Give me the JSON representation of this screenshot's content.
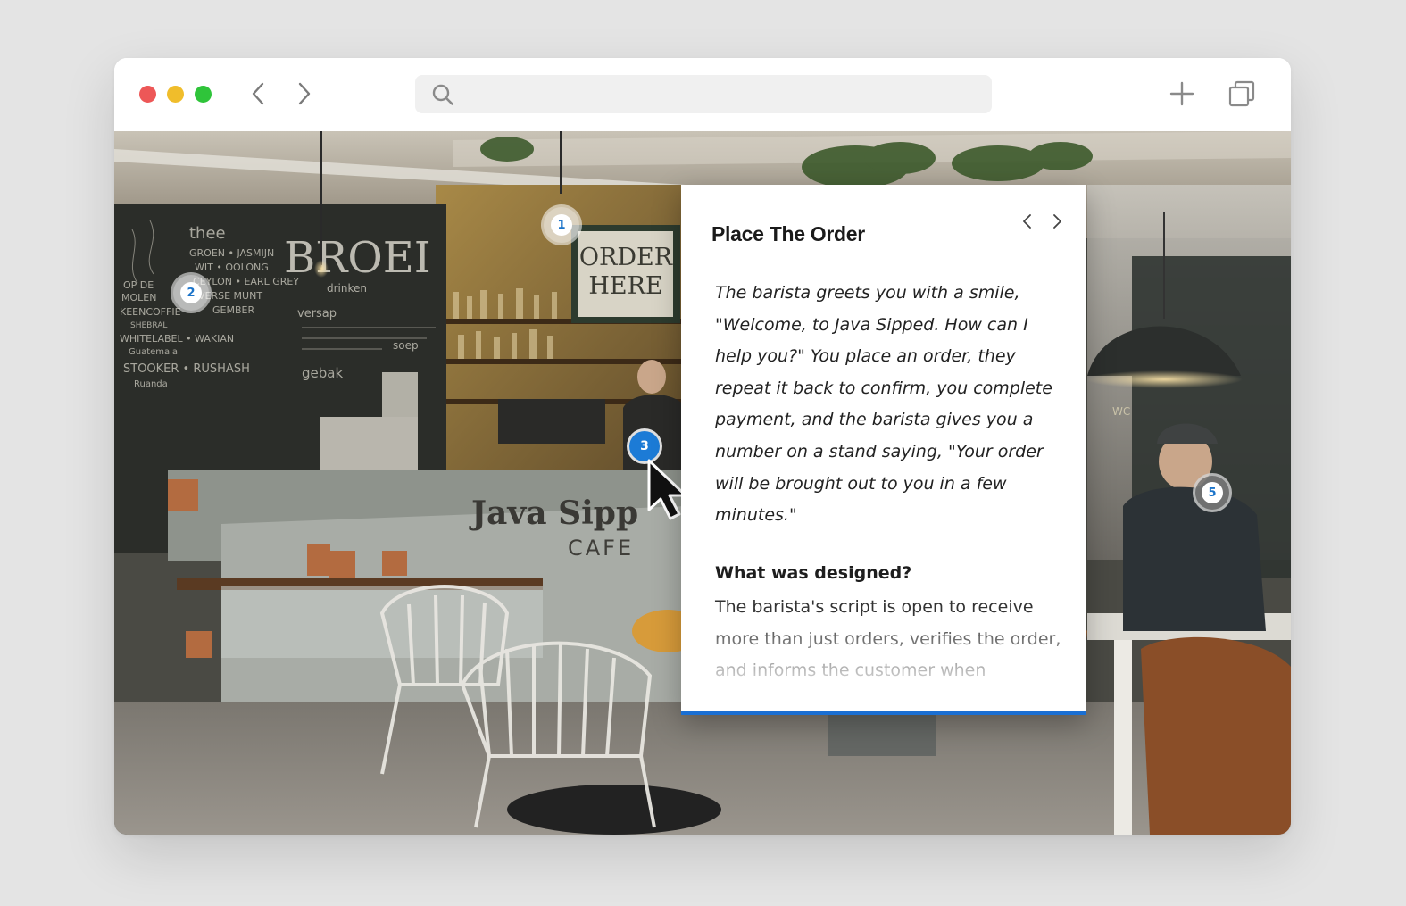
{
  "browser": {
    "address_value": "",
    "controls": [
      "close",
      "minimize",
      "maximize",
      "back",
      "forward",
      "new-tab",
      "tab-overview"
    ]
  },
  "scene": {
    "signage": {
      "chalkboard_brand": "BROEI",
      "chalkboard_sub": "drinken",
      "chalkboard_items": [
        "thee",
        "GROEN • JASMIJN",
        "WIT • OOLONG",
        "CEYLON • EARL GREY",
        "VERSE MUNT",
        "GEMBER",
        "OP DE",
        "MOLEN",
        "KEENCOFFIE",
        "SHEBRAL",
        "WHITELABEL • WAKIAN",
        "Guatemala",
        "STOOKER • RUSHASH",
        "Ruanda",
        "versap",
        "soep",
        "gebak"
      ],
      "order_sign_line1": "ORDER",
      "order_sign_line2": "HERE",
      "counter_name": "Java Sipp",
      "counter_sub": "CAFE",
      "wc_sign": "WC"
    }
  },
  "hotspots": [
    {
      "number": "1",
      "state": "default"
    },
    {
      "number": "2",
      "state": "default"
    },
    {
      "number": "3",
      "state": "active"
    },
    {
      "number": "5",
      "state": "default"
    }
  ],
  "popup": {
    "title": "Place The Order",
    "quote": "The barista greets you with a smile, \"Welcome, to Java Sipped. How can I help you?\" You place an order, they repeat it back to confirm, you complete payment, and the barista gives you a number on a stand saying, \"Your order will be brought out to you in a few minutes.\"",
    "subheading": "What was designed?",
    "body": "The barista's script is open to receive more than just orders, verifies the order, and informs the customer when",
    "accent_color": "#1a6fd3"
  }
}
